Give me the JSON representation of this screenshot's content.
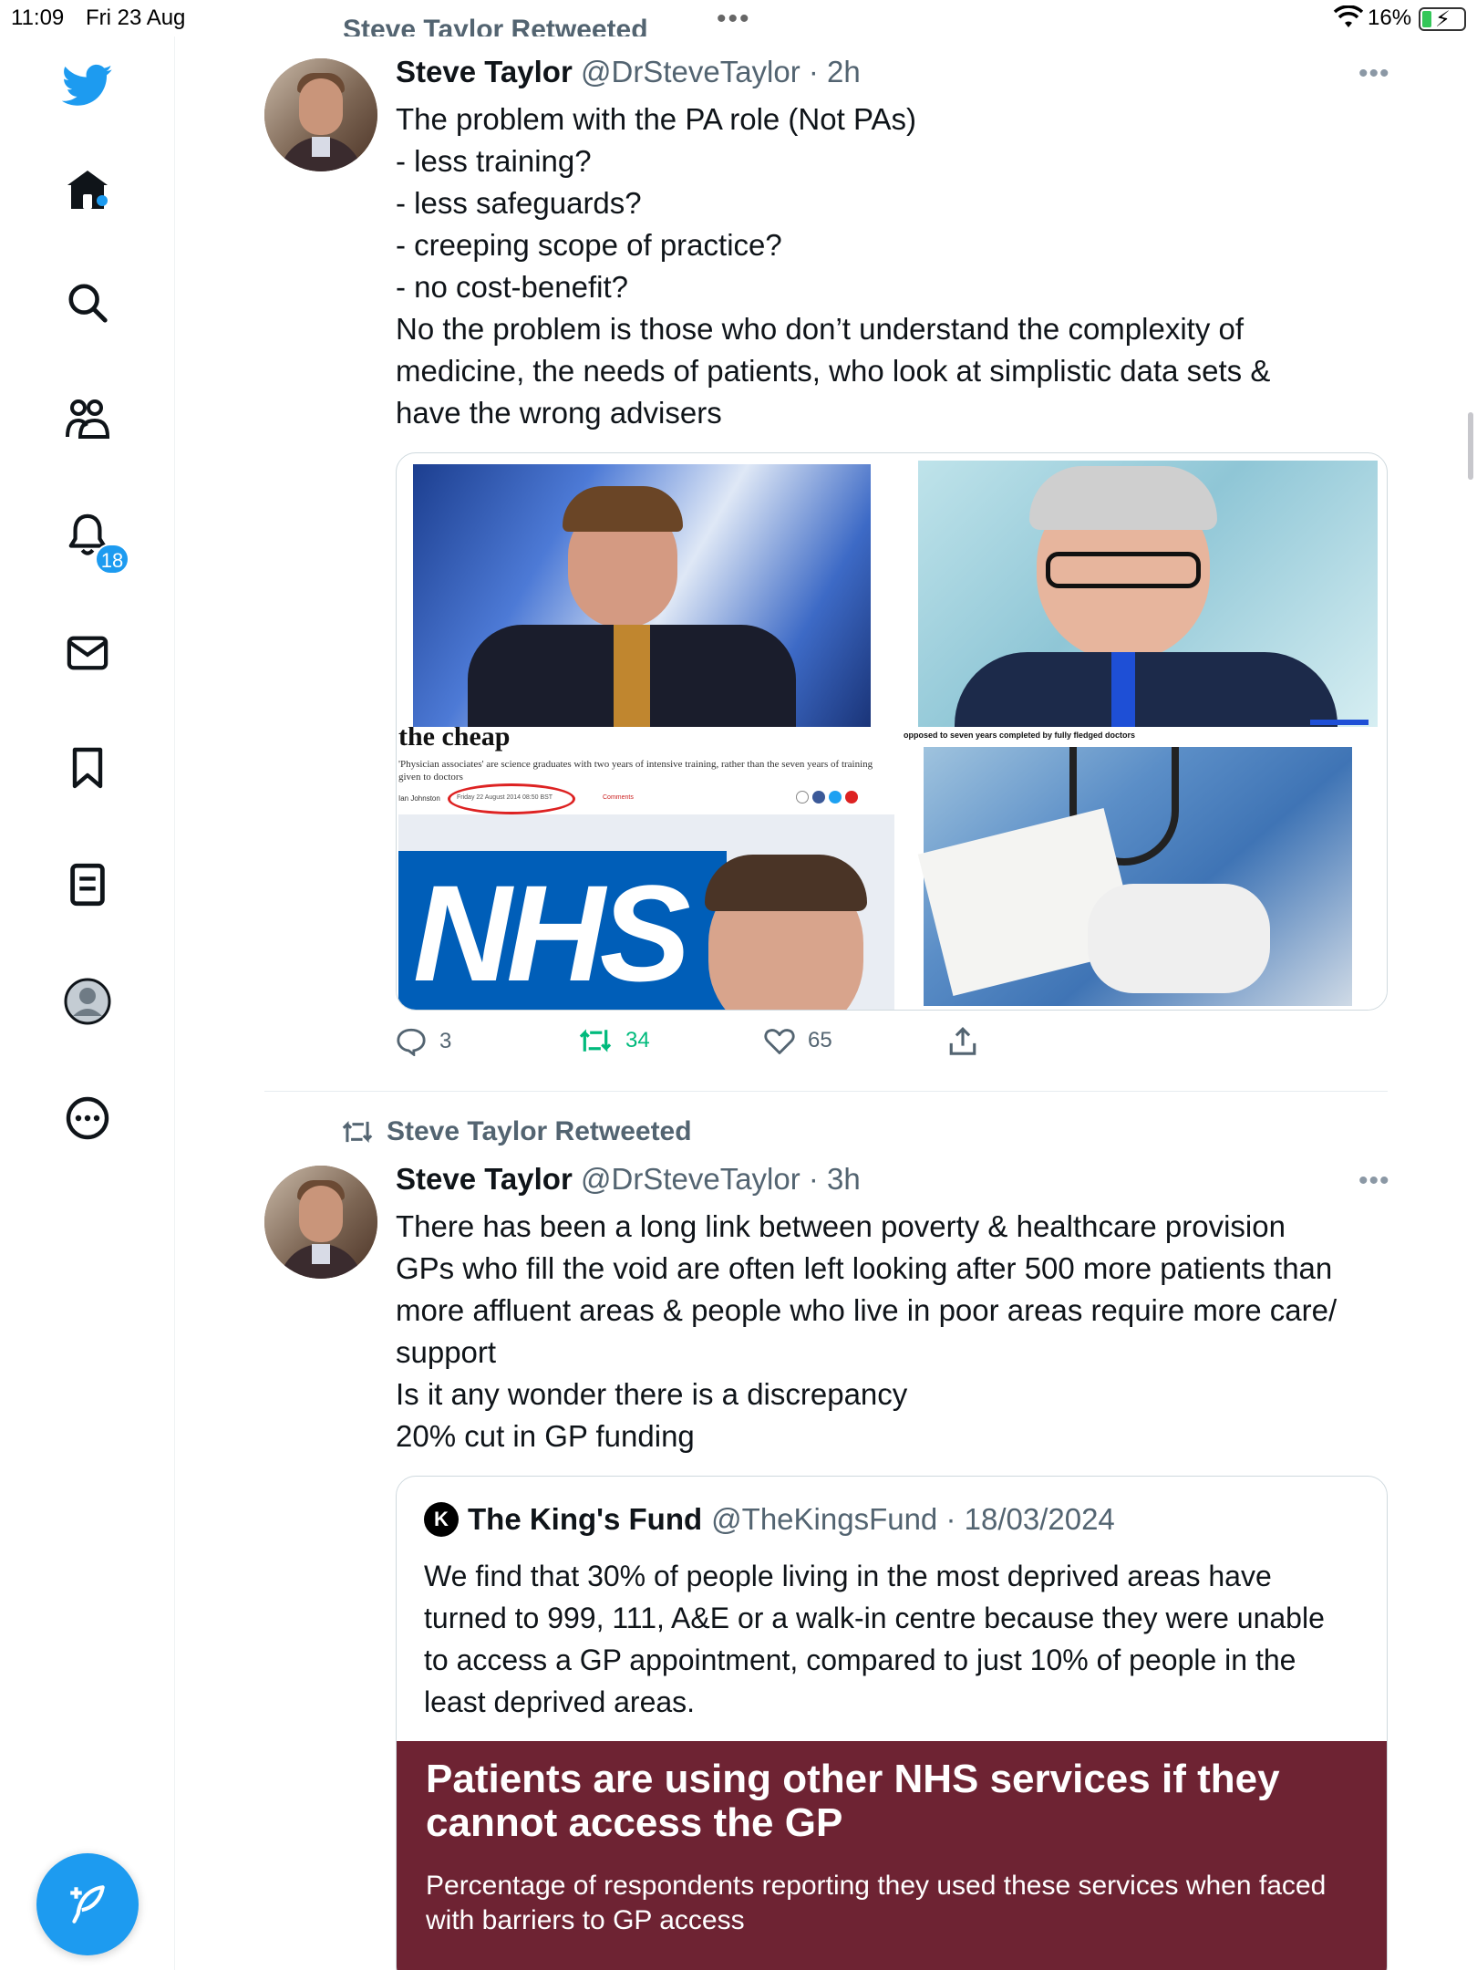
{
  "status_bar": {
    "time": "11:09",
    "date": "Fri 23 Aug",
    "battery_pct": "16%"
  },
  "sidebar": {
    "notifications_badge": "18",
    "items": [
      "twitter-logo",
      "home-icon",
      "search-icon",
      "communities-icon",
      "notifications-icon",
      "messages-icon",
      "bookmarks-icon",
      "lists-icon",
      "profile-icon",
      "more-icon"
    ]
  },
  "feed": {
    "tweets": [
      {
        "retweet_label_top": "Steve Taylor Retweeted",
        "name": "Steve Taylor",
        "meta": "@DrSteveTaylor · 2h",
        "text": "The problem with the PA role (Not PAs)\n- less training?\n- less safeguards?\n- creeping scope of practice?\n- no cost-benefit?\nNo the problem is those who don’t understand the complexity of medicine, the needs of patients, who look at simplistic data sets & have the wrong advisers",
        "media": {
          "article_headline": "the cheap",
          "article_sub": "'Physician associates' are science graduates with two years of intensive training, rather than the seven years of training given to doctors",
          "article_author": "Ian Johnston",
          "article_date": "Friday 22 August 2014 08:50 BST",
          "article_comments": "Comments",
          "nhs_logo": "NHS",
          "top_caption": "opposed to seven years completed by fully fledged doctors"
        },
        "stats": {
          "replies": "3",
          "retweets": "34",
          "likes": "65"
        }
      },
      {
        "retweet_label": "Steve Taylor Retweeted",
        "name": "Steve Taylor",
        "meta": "@DrSteveTaylor · 3h",
        "text": "There has been a long link between poverty & healthcare provision\nGPs who fill the void are often left looking after 500 more patients than more affluent areas & people who live in poor areas require more care/ support\nIs it any wonder there is a discrepancy\n20% cut in GP funding",
        "quote": {
          "logo_letter": "K",
          "name": "The King's Fund",
          "meta": "@TheKingsFund · 18/03/2024",
          "text": "We find that 30% of people living in the most deprived areas have turned to 999, 111, A&E or a walk-in centre because they were unable to access a GP appointment, compared to just 10% of people in the least deprived areas.",
          "banner_title": "Patients are using other NHS services if they cannot access the GP",
          "banner_sub": "Percentage of respondents reporting they used these services when faced with barriers to GP access"
        }
      }
    ]
  },
  "colors": {
    "accent": "#1d9bf0",
    "retweet_green": "#00ba7c",
    "banner": "#6e2333",
    "muted": "#536471"
  }
}
